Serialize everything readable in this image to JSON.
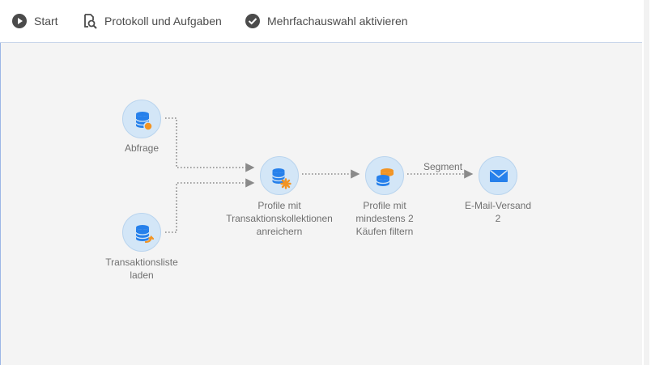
{
  "toolbar": {
    "start_label": "Start",
    "log_label": "Protokoll und Aufgaben",
    "multiselect_label": "Mehrfachauswahl aktivieren"
  },
  "nodes": {
    "abfrage": {
      "label": "Abfrage",
      "icon": "query-icon"
    },
    "transaktionsliste": {
      "line1": "Transaktionsliste",
      "line2": "laden",
      "icon": "load-list-icon"
    },
    "anreichern": {
      "line1": "Profile mit",
      "line2": "Transaktionskollektionen",
      "line3": "anreichern",
      "icon": "enrich-icon"
    },
    "filtern": {
      "line1": "Profile mit",
      "line2": "mindestens 2",
      "line3": "Käufen filtern",
      "icon": "filter-icon"
    },
    "versand": {
      "line1": "E-Mail-Versand",
      "line2": "2",
      "icon": "email-icon"
    }
  },
  "transitions": {
    "segment_label": "Segment"
  },
  "colors": {
    "accent_blue": "#2680eb",
    "node_fill": "#d3e6f7",
    "orange": "#f29423",
    "wire": "#8a8a8a",
    "canvas_bg": "#f4f4f4"
  }
}
